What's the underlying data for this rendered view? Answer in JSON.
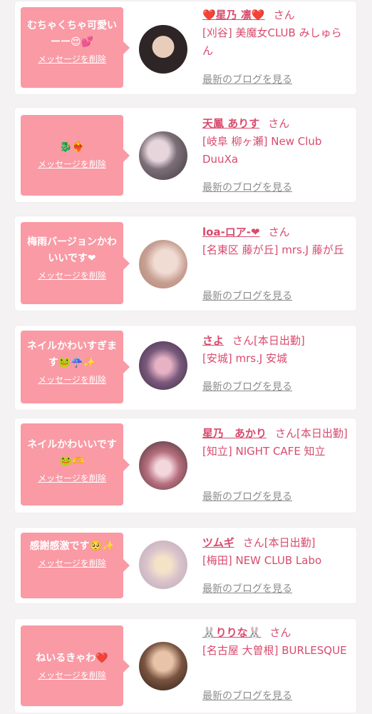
{
  "common": {
    "delete_label": "メッセージを削除",
    "blog_label": "最新のブログを見る",
    "honorific": "さん"
  },
  "cards": [
    {
      "message": "むちゃくちゃ可愛いーー😍💕",
      "name": "❤️星乃 凛❤️",
      "status": "",
      "shop": "[刈谷] 美魔女CLUB みしゅらん",
      "avatar_color": "#3a3030"
    },
    {
      "message": "🐉❤️‍🔥",
      "name": "天鳳 ありす",
      "status": "",
      "shop": "[岐阜 柳ヶ瀬] New Club DuuXa",
      "avatar_color": "#6b5d66"
    },
    {
      "message": "梅雨バージョンかわいいです❤",
      "name": "loa-ロア-❤",
      "status": "",
      "shop": "[名東区 藤が丘] mrs.J 藤が丘",
      "avatar_color": "#d9b7aa"
    },
    {
      "message": "ネイルかわいすぎます🐸☔️✨",
      "name": "さよ",
      "status": "[本日出勤]",
      "shop": "[安城] mrs.J 安城",
      "avatar_color": "#5a3f58"
    },
    {
      "message": "ネイルかわいいです🐸🫶",
      "name": "星乃　あかり",
      "status": "[本日出勤]",
      "shop": "[知立] NIGHT CAFE 知立",
      "avatar_color": "#7a4a58"
    },
    {
      "message": "感謝感激です🥺✨",
      "name": "ツムギ",
      "status": "[本日出勤]",
      "shop": "[梅田] NEW CLUB Labo",
      "avatar_color": "#d6c8d0"
    },
    {
      "message": "ねいるきゃわ❤️",
      "name": "🐰りりな🐰",
      "status": "",
      "shop": "[名古屋 大曽根] BURLESQUE",
      "avatar_color": "#4a3228"
    }
  ]
}
